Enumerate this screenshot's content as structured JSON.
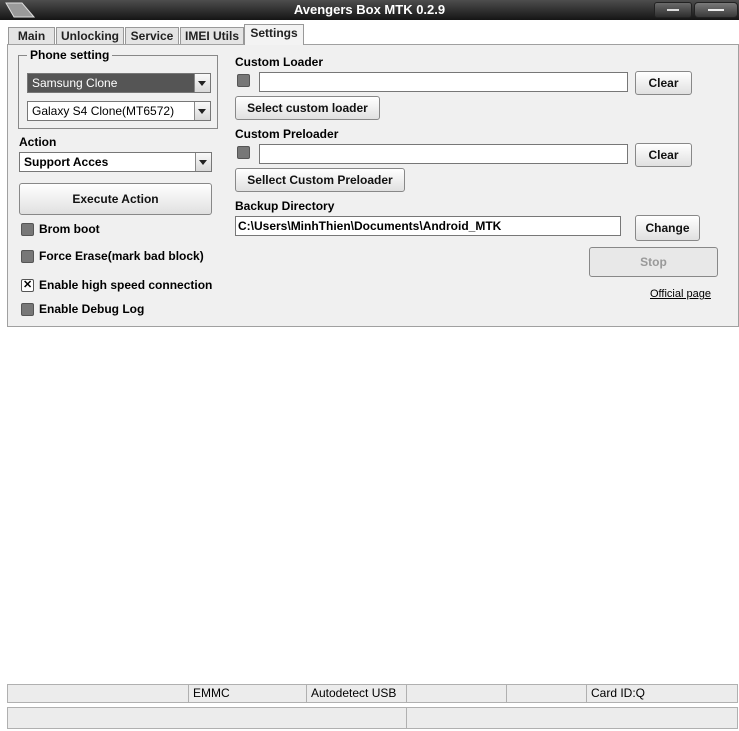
{
  "window": {
    "title": "Avengers Box MTK 0.2.9"
  },
  "tabs": [
    {
      "label": "Main"
    },
    {
      "label": "Unlocking"
    },
    {
      "label": "Service"
    },
    {
      "label": "IMEI Utils"
    },
    {
      "label": "Settings",
      "active": true
    }
  ],
  "phone_setting": {
    "legend": "Phone setting",
    "brand": "Samsung Clone",
    "model": "Galaxy S4 Clone(MT6572)"
  },
  "action": {
    "label": "Action",
    "selected": "Support Acces",
    "execute_label": "Execute Action"
  },
  "options": [
    {
      "label": "Brom boot",
      "checked": false
    },
    {
      "label": "Force Erase(mark bad block)",
      "checked": false
    },
    {
      "label": "Enable high speed connection",
      "checked": true
    },
    {
      "label": "Enable Debug Log",
      "checked": false
    }
  ],
  "custom_loader": {
    "label": "Custom Loader",
    "value": "",
    "clear_label": "Clear",
    "select_label": "Select custom loader"
  },
  "custom_preloader": {
    "label": "Custom Preloader",
    "value": "",
    "clear_label": "Clear",
    "select_label": "Sellect Custom Preloader"
  },
  "backup": {
    "label": "Backup Directory",
    "value": "C:\\Users\\MinhThien\\Documents\\Android_MTK",
    "change_label": "Change"
  },
  "stop_label": "Stop",
  "official_link": "Official page",
  "status": {
    "storage": "EMMC",
    "usb": "Autodetect USB",
    "card": "Card ID:Q"
  },
  "colors": {
    "titlebar": "#1e1e1e",
    "panel": "#f0f0f0",
    "selected_combo": "#555555"
  },
  "icons": [
    "app-icon",
    "minimize-icon",
    "close-icon",
    "dropdown-arrow-icon",
    "checkbox-icon"
  ]
}
